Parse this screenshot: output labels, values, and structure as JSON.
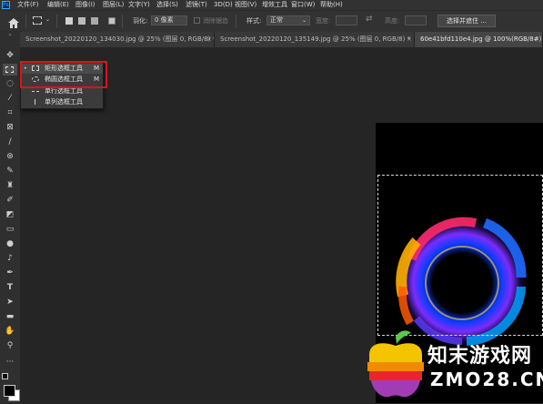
{
  "menubar": {
    "app_icon": "Ps",
    "items": [
      "文件(F)",
      "编辑(E)",
      "图像(I)",
      "图层(L)",
      "文字(Y)",
      "选择(S)",
      "滤镜(T)",
      "3D(D)",
      "视图(V)",
      "增效工具",
      "窗口(W)",
      "帮助(H)"
    ]
  },
  "options": {
    "feather_label": "羽化:",
    "feather_value": "0 像素",
    "antialias_label": "消除锯齿",
    "style_label": "样式:",
    "style_value": "正常",
    "width_label": "宽度:",
    "height_label": "高度:",
    "select_mask_label": "选择并遮住 ..."
  },
  "tabs": [
    {
      "label": "Screenshot_20220120_134030.jpg @ 25% (图层 0, RGB/8) *",
      "close": "×"
    },
    {
      "label": "Screenshot_20220120_135149.jpg @ 25% (图层 0, RGB/8) *",
      "close": "×"
    },
    {
      "label": "60e41bfd110e4.jpg @ 100%(RGB/8#) *",
      "close": "×"
    }
  ],
  "toolbar": {
    "tools": [
      "move-tool",
      "marquee-tool",
      "lasso-tool",
      "magic-wand-tool",
      "crop-tool",
      "frame-tool",
      "eyedropper-tool",
      "spot-healing-tool",
      "brush-tool",
      "clone-stamp-tool",
      "history-brush-tool",
      "eraser-tool",
      "gradient-tool",
      "blur-tool",
      "dodge-tool",
      "pen-tool",
      "type-tool",
      "path-selection-tool",
      "rectangle-tool",
      "hand-tool",
      "zoom-tool",
      "more-tools"
    ]
  },
  "flyout": {
    "items": [
      {
        "label": "矩形选框工具",
        "shortcut": "M",
        "icon": "rect-marquee-icon"
      },
      {
        "label": "椭圆选框工具",
        "shortcut": "M",
        "icon": "ellipse-marquee-icon"
      },
      {
        "label": "单行选框工具",
        "shortcut": "",
        "icon": "single-row-marquee-icon"
      },
      {
        "label": "单列选框工具",
        "shortcut": "",
        "icon": "single-column-marquee-icon"
      }
    ]
  },
  "watermark": {
    "line1": "知末游戏网",
    "line2": "ZMO28.CN"
  },
  "colors": {
    "highlight": "#e0101a",
    "foreground": "#000000",
    "background": "#ffffff"
  }
}
